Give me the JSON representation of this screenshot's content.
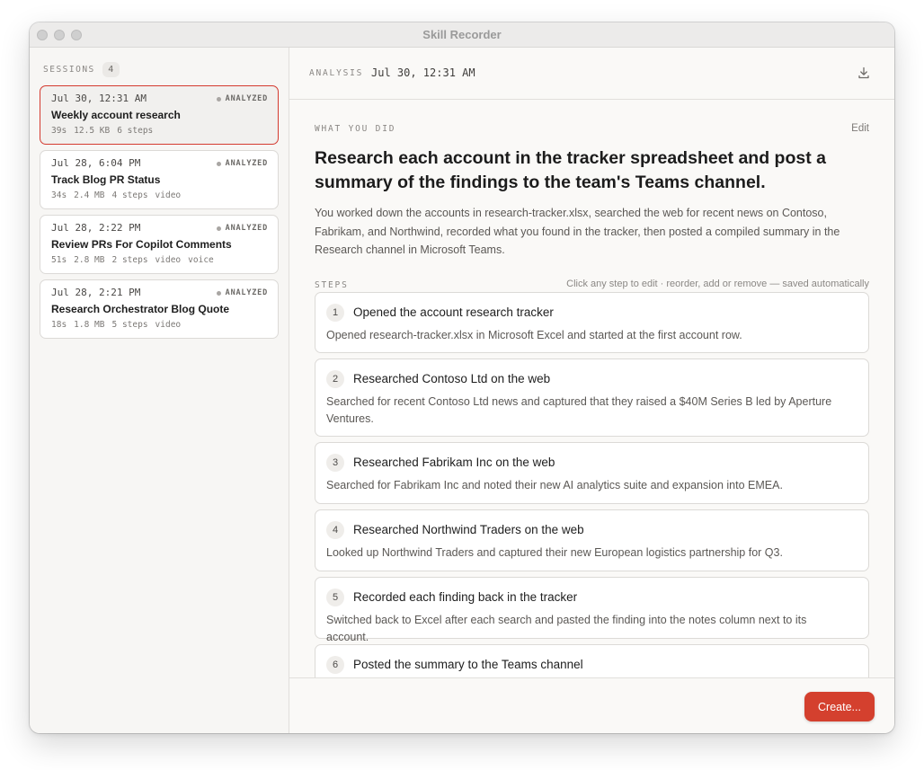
{
  "window": {
    "title": "Skill Recorder"
  },
  "sidebar": {
    "label": "SESSIONS",
    "count": "4",
    "sessions": [
      {
        "date": "Jul 30, 12:31 AM",
        "status": "ANALYZED",
        "title": "Weekly account research",
        "duration": "39s",
        "size": "12.5 KB",
        "steps": "6 steps",
        "tags": []
      },
      {
        "date": "Jul 28, 6:04 PM",
        "status": "ANALYZED",
        "title": "Track Blog PR Status",
        "duration": "34s",
        "size": "2.4 MB",
        "steps": "4 steps",
        "tags": [
          "video"
        ]
      },
      {
        "date": "Jul 28, 2:22 PM",
        "status": "ANALYZED",
        "title": "Review PRs For Copilot Comments",
        "duration": "51s",
        "size": "2.8 MB",
        "steps": "2 steps",
        "tags": [
          "video",
          "voice"
        ]
      },
      {
        "date": "Jul 28, 2:21 PM",
        "status": "ANALYZED",
        "title": "Research Orchestrator Blog Quote",
        "duration": "18s",
        "size": "1.8 MB",
        "steps": "5 steps",
        "tags": [
          "video"
        ]
      }
    ]
  },
  "analysis": {
    "label": "ANALYSIS",
    "date": "Jul 30, 12:31 AM",
    "download_icon": "download-icon"
  },
  "what_you_did": {
    "label": "WHAT YOU DID",
    "edit_label": "Edit",
    "headline": "Research each account in the tracker spreadsheet and post a summary of the findings to the team's Teams channel.",
    "summary": "You worked down the accounts in research-tracker.xlsx, searched the web for recent news on Contoso, Fabrikam, and Northwind, recorded what you found in the tracker, then posted a compiled summary in the Research channel in Microsoft Teams."
  },
  "steps": {
    "label": "STEPS",
    "hint": "Click any step to edit · reorder, add or remove — saved automatically",
    "items": [
      {
        "num": "1",
        "title": "Opened the account research tracker",
        "desc": "Opened research-tracker.xlsx in Microsoft Excel and started at the first account row."
      },
      {
        "num": "2",
        "title": "Researched Contoso Ltd on the web",
        "desc": "Searched for recent Contoso Ltd news and captured that they raised a $40M Series B led by Aperture Ventures."
      },
      {
        "num": "3",
        "title": "Researched Fabrikam Inc on the web",
        "desc": "Searched for Fabrikam Inc and noted their new AI analytics suite and expansion into EMEA."
      },
      {
        "num": "4",
        "title": "Researched Northwind Traders on the web",
        "desc": "Looked up Northwind Traders and captured their new European logistics partnership for Q3."
      },
      {
        "num": "5",
        "title": "Recorded each finding back in the tracker",
        "desc": "Switched back to Excel after each search and pasted the finding into the notes column next to its account."
      },
      {
        "num": "6",
        "title": "Posted the summary to the Teams channel",
        "desc": ""
      }
    ]
  },
  "footer": {
    "create_label": "Create..."
  },
  "colors": {
    "accent": "#d4402e",
    "active_border": "#d43a2f"
  }
}
